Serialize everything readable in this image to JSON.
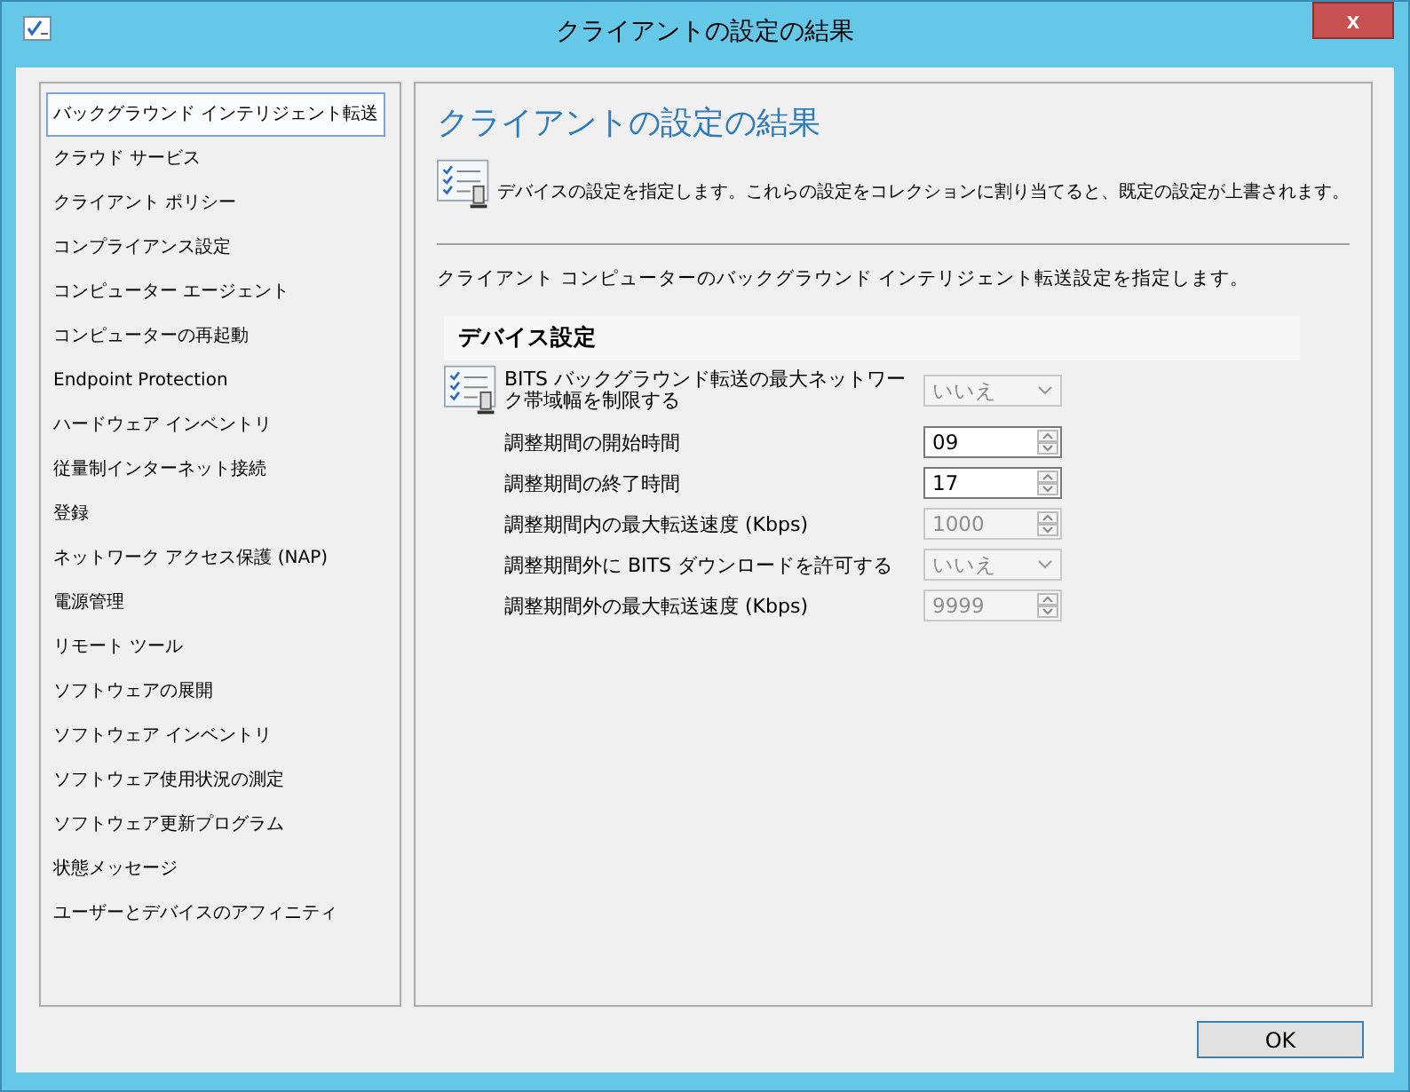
{
  "window": {
    "title": "クライアントの設定の結果",
    "close": "x"
  },
  "sidebar": {
    "items": [
      {
        "label": "バックグラウンド インテリジェント転送",
        "selected": true
      },
      {
        "label": "クラウド サービス",
        "selected": false
      },
      {
        "label": "クライアント ポリシー",
        "selected": false
      },
      {
        "label": "コンプライアンス設定",
        "selected": false
      },
      {
        "label": "コンピューター エージェント",
        "selected": false
      },
      {
        "label": "コンピューターの再起動",
        "selected": false
      },
      {
        "label": "Endpoint Protection",
        "selected": false
      },
      {
        "label": "ハードウェア インベントリ",
        "selected": false
      },
      {
        "label": "従量制インターネット接続",
        "selected": false
      },
      {
        "label": "登録",
        "selected": false
      },
      {
        "label": "ネットワーク アクセス保護 (NAP)",
        "selected": false
      },
      {
        "label": "電源管理",
        "selected": false
      },
      {
        "label": "リモート ツール",
        "selected": false
      },
      {
        "label": "ソフトウェアの展開",
        "selected": false
      },
      {
        "label": "ソフトウェア インベントリ",
        "selected": false
      },
      {
        "label": "ソフトウェア使用状況の測定",
        "selected": false
      },
      {
        "label": "ソフトウェア更新プログラム",
        "selected": false
      },
      {
        "label": "状態メッセージ",
        "selected": false
      },
      {
        "label": "ユーザーとデバイスのアフィニティ",
        "selected": false
      }
    ]
  },
  "content": {
    "heading": "クライアントの設定の結果",
    "description": "デバイスの設定を指定します。これらの設定をコレクションに割り当てると、既定の設定が上書されます。",
    "intro": "クライアント コンピューターのバックグラウンド インテリジェント転送設定を指定します。",
    "section_title": "デバイス設定",
    "settings": [
      {
        "kind": "dropdown",
        "label": "BITS バックグラウンド転送の最大ネットワーク帯域幅を制限する",
        "value": "いいえ",
        "disabled": true
      },
      {
        "kind": "spinner",
        "label": "調整期間の開始時間",
        "value": "09",
        "disabled": false
      },
      {
        "kind": "spinner",
        "label": "調整期間の終了時間",
        "value": "17",
        "disabled": false
      },
      {
        "kind": "spinner",
        "label": "調整期間内の最大転送速度 (Kbps)",
        "value": "1000",
        "disabled": true
      },
      {
        "kind": "dropdown",
        "label": "調整期間外に BITS ダウンロードを許可する",
        "value": "いいえ",
        "disabled": true
      },
      {
        "kind": "spinner",
        "label": "調整期間外の最大転送速度 (Kbps)",
        "value": "9999",
        "disabled": true
      }
    ]
  },
  "buttons": [
    "OK"
  ]
}
